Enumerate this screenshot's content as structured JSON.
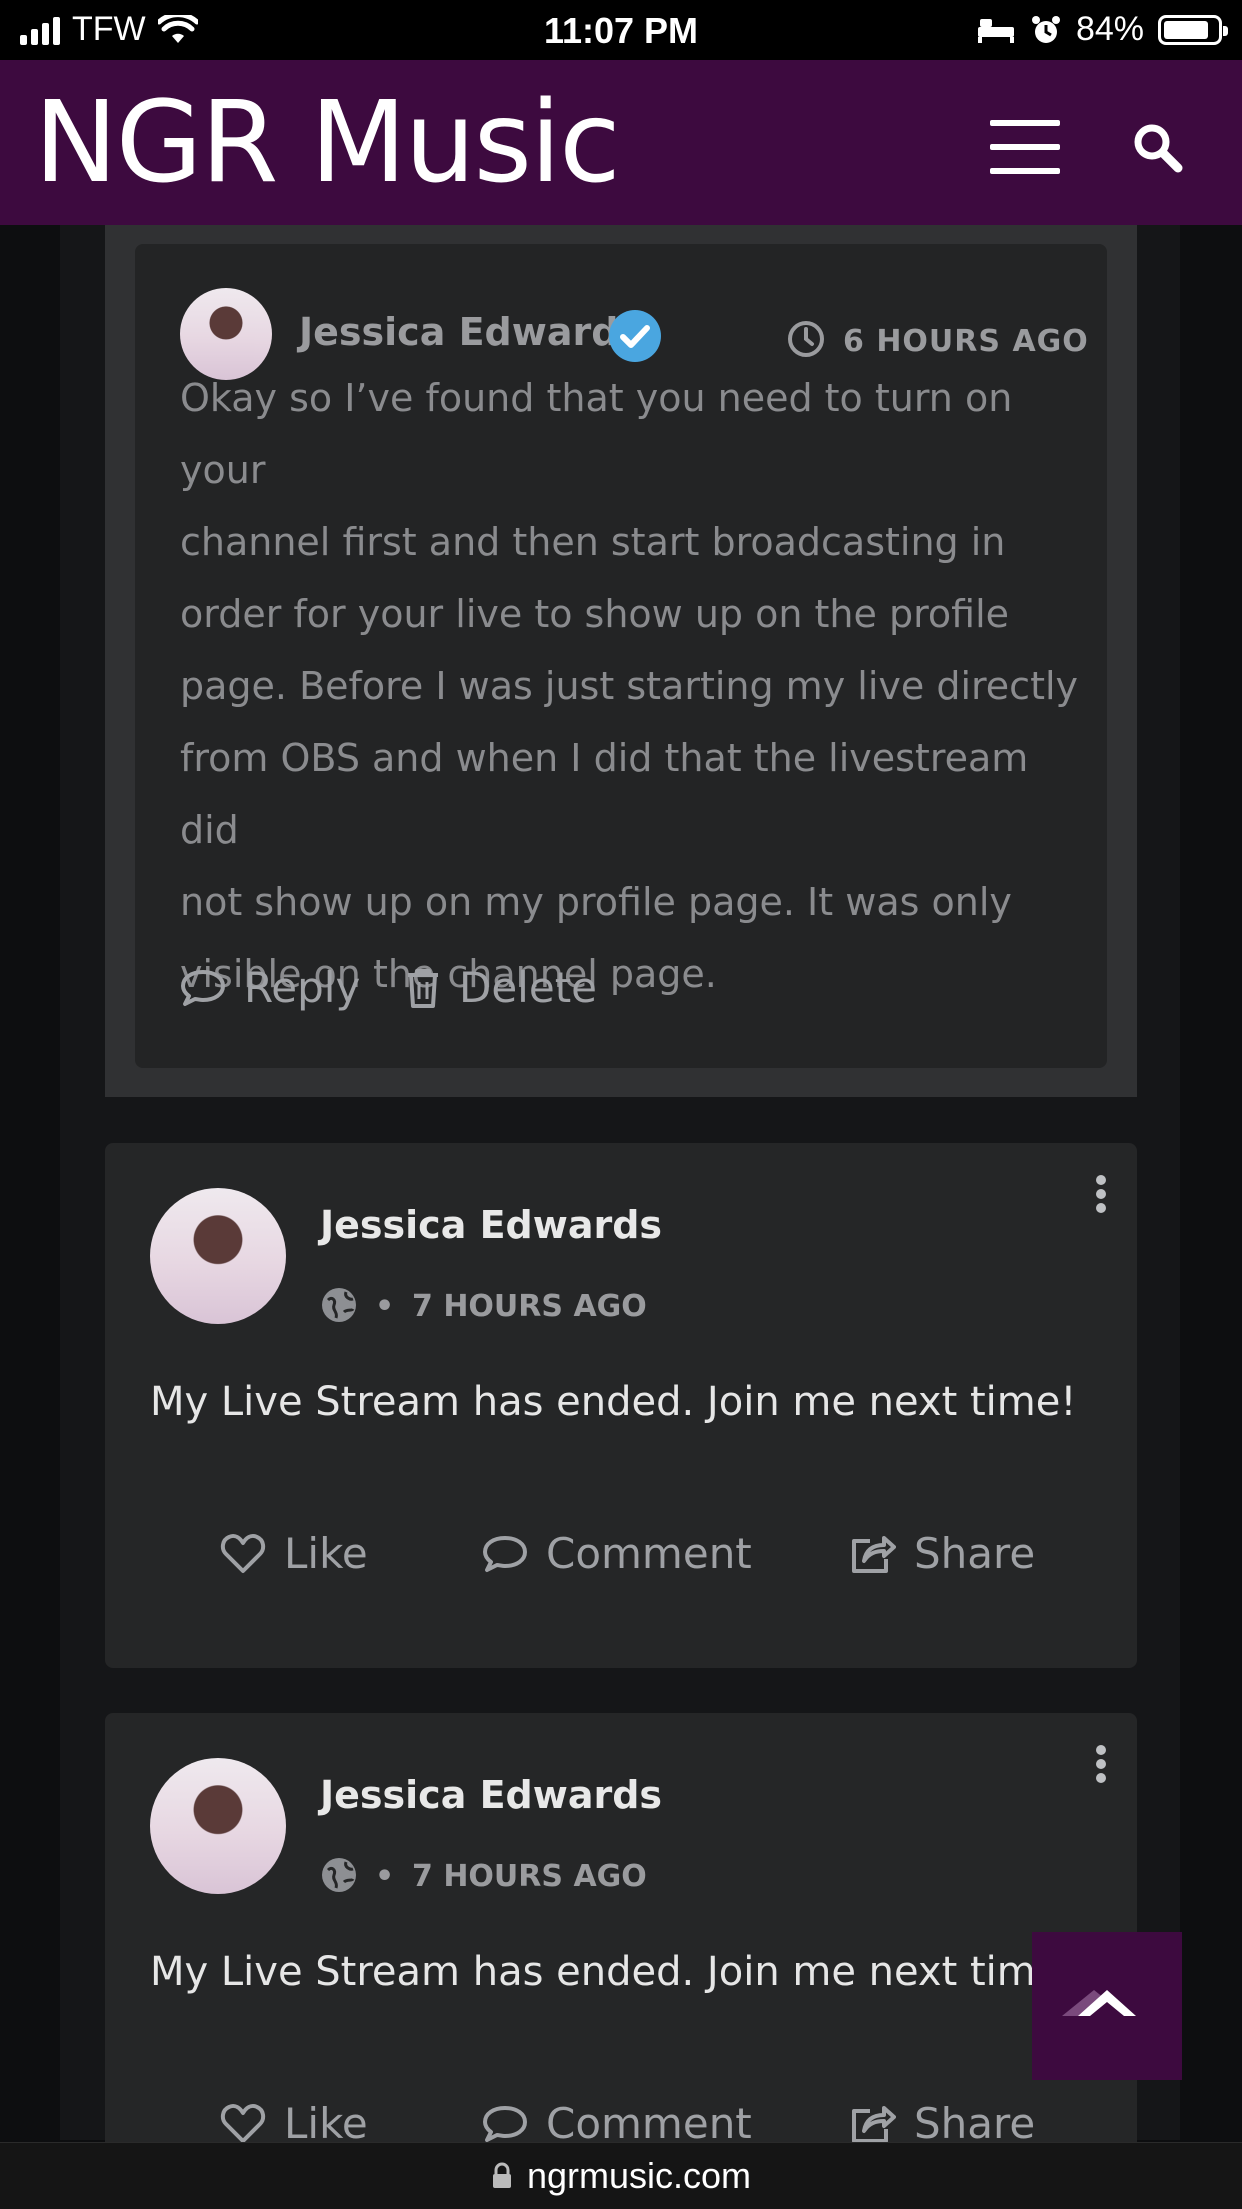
{
  "status_bar": {
    "carrier": "TFW",
    "time": "11:07 PM",
    "battery_percent": "84%",
    "battery_level": 0.84
  },
  "header": {
    "title": "NGR Music",
    "menu_icon": "hamburger-icon",
    "search_icon": "search-icon"
  },
  "reply": {
    "author": "Jessica Edwards",
    "verified": true,
    "time": "6 HOURS AGO",
    "text_lines": [
      "Okay so I’ve found that you need to turn on your",
      "channel first and then start broadcasting in",
      "order for your live to show up on the profile",
      "page. Before I was just starting my live directly",
      "from OBS and when I did that the livestream did",
      "not show up on my profile page. It was only",
      "visible on the channel page."
    ],
    "reply_label": "Reply",
    "delete_label": "Delete"
  },
  "posts": [
    {
      "author": "Jessica Edwards",
      "time": "7 HOURS AGO",
      "text": "My Live Stream has ended. Join me next time!",
      "like_label": "Like",
      "comment_label": "Comment",
      "share_label": "Share"
    },
    {
      "author": "Jessica Edwards",
      "time": "7 HOURS AGO",
      "text": "My Live Stream has ended. Join me next time!",
      "like_label": "Like",
      "comment_label": "Comment",
      "share_label": "Share"
    }
  ],
  "footer": {
    "url": "ngrmusic.com"
  },
  "colors": {
    "brand": "#3d0a3f",
    "verified": "#4aa6e0",
    "background": "#0d0e10",
    "card": "#252627"
  }
}
